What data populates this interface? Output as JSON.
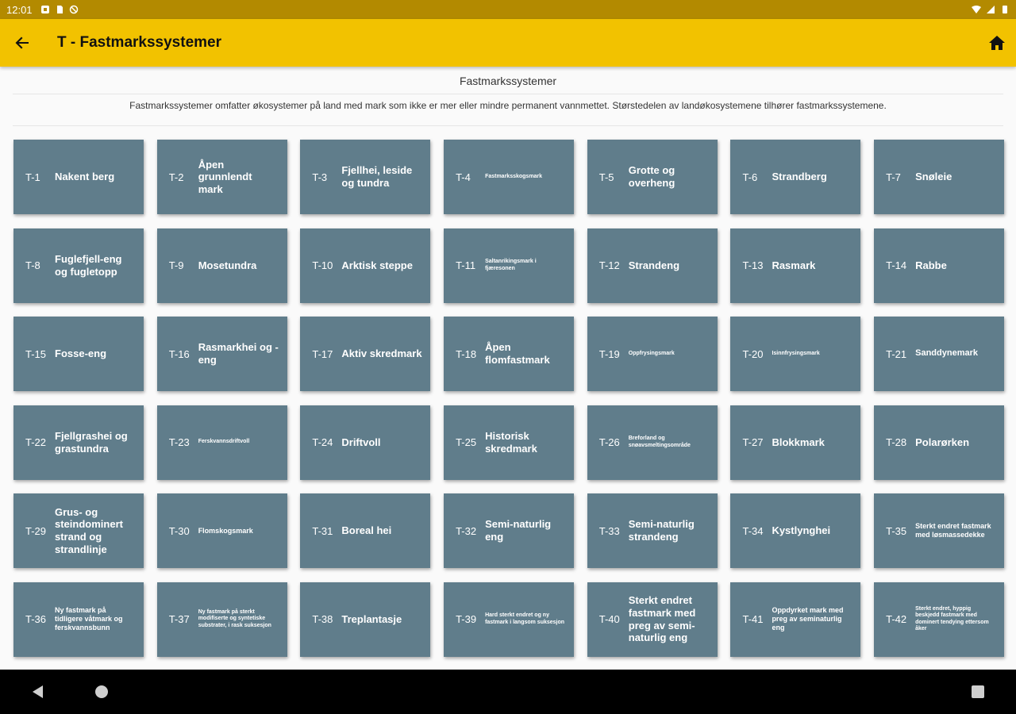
{
  "status": {
    "time": "12:01"
  },
  "appbar": {
    "title": "T - Fastmarkssystemer"
  },
  "page": {
    "heading": "Fastmarkssystemer",
    "description": "Fastmarkssystemer omfatter økosystemer på land med mark som ikke er mer eller mindre permanent vannmettet. Størstedelen av landøkosystemene tilhører fastmarkssystemene."
  },
  "tiles": [
    {
      "code": "T-1",
      "name": "Nakent berg"
    },
    {
      "code": "T-2",
      "name": "Åpen grunnlendt mark"
    },
    {
      "code": "T-3",
      "name": "Fjellhei, leside og tundra"
    },
    {
      "code": "T-4",
      "name": "Fastmarksskogsmark"
    },
    {
      "code": "T-5",
      "name": "Grotte og overheng"
    },
    {
      "code": "T-6",
      "name": "Strandberg"
    },
    {
      "code": "T-7",
      "name": "Snøleie"
    },
    {
      "code": "T-8",
      "name": "Fuglefjell-eng og fugletopp"
    },
    {
      "code": "T-9",
      "name": "Mosetundra"
    },
    {
      "code": "T-10",
      "name": "Arktisk steppe"
    },
    {
      "code": "T-11",
      "name": "Saltanrikingsmark i fjæresonen"
    },
    {
      "code": "T-12",
      "name": "Strandeng"
    },
    {
      "code": "T-13",
      "name": "Rasmark"
    },
    {
      "code": "T-14",
      "name": "Rabbe"
    },
    {
      "code": "T-15",
      "name": "Fosse-eng"
    },
    {
      "code": "T-16",
      "name": "Rasmarkhei og -eng"
    },
    {
      "code": "T-17",
      "name": "Aktiv skredmark"
    },
    {
      "code": "T-18",
      "name": "Åpen flomfastmark"
    },
    {
      "code": "T-19",
      "name": "Oppfrysingsmark"
    },
    {
      "code": "T-20",
      "name": "Isinnfrysingsmark"
    },
    {
      "code": "T-21",
      "name": "Sanddynemark"
    },
    {
      "code": "T-22",
      "name": "Fjellgrashei og grastundra"
    },
    {
      "code": "T-23",
      "name": "Ferskvannsdriftvoll"
    },
    {
      "code": "T-24",
      "name": "Driftvoll"
    },
    {
      "code": "T-25",
      "name": "Historisk skredmark"
    },
    {
      "code": "T-26",
      "name": "Breforland og snøavsmeltingsområde"
    },
    {
      "code": "T-27",
      "name": "Blokkmark"
    },
    {
      "code": "T-28",
      "name": "Polarørken"
    },
    {
      "code": "T-29",
      "name": "Grus- og steindominert strand og strandlinje"
    },
    {
      "code": "T-30",
      "name": "Flomskogsmark"
    },
    {
      "code": "T-31",
      "name": "Boreal hei"
    },
    {
      "code": "T-32",
      "name": "Semi-naturlig eng"
    },
    {
      "code": "T-33",
      "name": "Semi-naturlig strandeng"
    },
    {
      "code": "T-34",
      "name": "Kystlynghei"
    },
    {
      "code": "T-35",
      "name": "Sterkt endret fastmark med løsmassedekke"
    },
    {
      "code": "T-36",
      "name": "Ny fastmark på tidligere våtmark og ferskvannsbunn"
    },
    {
      "code": "T-37",
      "name": "Ny fastmark på sterkt modifiserte og syntetiske substrater, i rask suksesjon"
    },
    {
      "code": "T-38",
      "name": "Treplantasje"
    },
    {
      "code": "T-39",
      "name": "Hard sterkt endret og ny fastmark i langsom suksesjon"
    },
    {
      "code": "T-40",
      "name": "Sterkt endret fastmark med preg av semi-naturlig eng"
    },
    {
      "code": "T-41",
      "name": "Oppdyrket mark med preg av seminaturlig eng"
    },
    {
      "code": "T-42",
      "name": "Sterkt endret, hyppig beskjedd fastmark med dominert tendying ettersom åker"
    }
  ],
  "colors": {
    "appbar": "#f2c200",
    "statusbar": "#b38a00",
    "tile": "#607d8b"
  },
  "icons": {
    "back": "arrow-back-icon",
    "home": "home-icon"
  }
}
